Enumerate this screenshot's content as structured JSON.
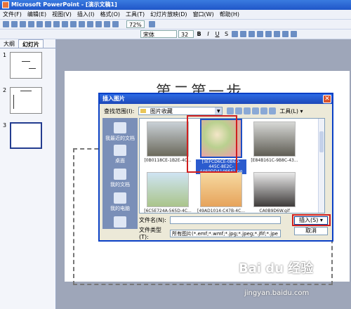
{
  "window": {
    "title": "Microsoft PowerPoint - [演示文稿1]"
  },
  "menu": [
    "文件(F)",
    "编辑(E)",
    "视图(V)",
    "插入(I)",
    "格式(O)",
    "工具(T)",
    "幻灯片放映(D)",
    "窗口(W)",
    "帮助(H)"
  ],
  "toolbar": {
    "zoom": "72%"
  },
  "formatbar": {
    "font": "宋体",
    "size": "32",
    "bold": "B",
    "italic": "I",
    "underline": "U",
    "shadow": "S"
  },
  "panel": {
    "tabs": [
      "大纲",
      "幻灯片"
    ],
    "slide_numbers": [
      "1",
      "2",
      "3"
    ]
  },
  "slide": {
    "title": "第二第一步"
  },
  "dialog": {
    "title": "插入图片",
    "look_in_label": "查找范围(I):",
    "look_in_value": "图片收藏",
    "tools_label": "工具(L) ▾",
    "places": [
      "我最近的文档",
      "桌面",
      "我的文档",
      "我的电脑",
      "网上邻居"
    ],
    "files": [
      {
        "name": "[0B0118CE-1B2E-4C..."
      },
      {
        "name": "[3EFCD6CE-0B6D-445C-8E2C-4469DD414664].jpg"
      },
      {
        "name": "[E84B161C-9B8C-43..."
      },
      {
        "name": "[6C5E724A-565D-4C..."
      },
      {
        "name": "[49AD1014-C47B-4C..."
      },
      {
        "name": "CA0B9D6W.gif"
      }
    ],
    "filename_label": "文件名(N):",
    "filename_value": "",
    "filetype_label": "文件类型(T):",
    "filetype_value": "所有图片(*.emf;*.wmf;*.jpg;*.jpeg;*.jfif;*.jpe",
    "insert_label": "插入(S) ▾",
    "cancel_label": "取消"
  },
  "watermark": {
    "brand": "Bai du 经验",
    "url": "jingyan.baidu.com"
  }
}
